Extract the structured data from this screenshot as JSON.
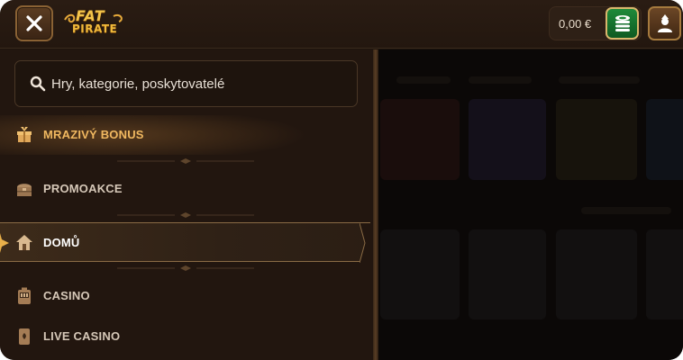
{
  "header": {
    "logo_line1": "FAT",
    "logo_line2": "PIRATE",
    "balance": "0,00 €",
    "icons": {
      "close": "close-icon",
      "deposit": "coins-icon",
      "profile": "user-icon"
    }
  },
  "menu": {
    "search": {
      "placeholder": "Hry, kategorie, poskytovatelé",
      "value": ""
    },
    "items": [
      {
        "label": "MRAZIVÝ BONUS",
        "icon": "gift-icon",
        "state": "highlighted"
      },
      {
        "label": "PROMOAKCE",
        "icon": "treasure-chest-icon",
        "state": "normal"
      },
      {
        "label": "DOMŮ",
        "icon": "home-icon",
        "state": "active"
      },
      {
        "label": "CASINO",
        "icon": "slot-machine-icon",
        "state": "normal"
      },
      {
        "label": "LIVE CASINO",
        "icon": "card-icon",
        "state": "normal"
      }
    ]
  },
  "colors": {
    "background": "#1d130d",
    "accent_gold": "#f0b860",
    "deposit_green": "#1e8a3a",
    "text": "#d6c8b8"
  }
}
